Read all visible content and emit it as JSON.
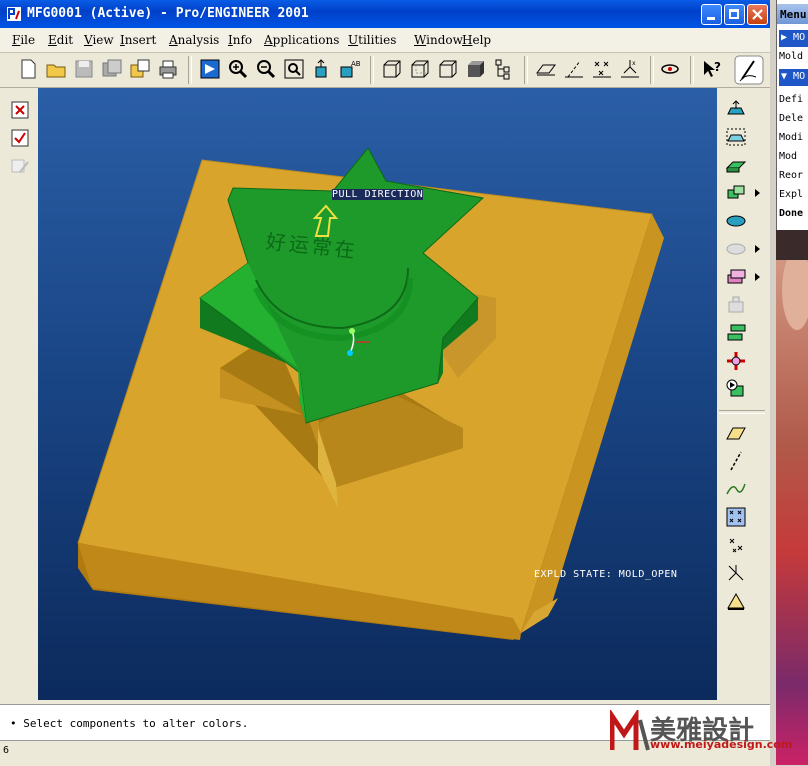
{
  "window": {
    "title": "MFG0001 (Active) - Pro/ENGINEER 2001"
  },
  "menu": {
    "items": [
      {
        "pre": "",
        "ul": "F",
        "rest": "ile"
      },
      {
        "pre": "",
        "ul": "E",
        "rest": "dit"
      },
      {
        "pre": "",
        "ul": "V",
        "rest": "iew"
      },
      {
        "pre": "",
        "ul": "I",
        "rest": "nsert"
      },
      {
        "pre": "",
        "ul": "A",
        "rest": "nalysis"
      },
      {
        "pre": "",
        "ul": "I",
        "rest": "nfo"
      },
      {
        "pre": "",
        "ul": "A",
        "rest": "pplications"
      },
      {
        "pre": "",
        "ul": "U",
        "rest": "tilities"
      },
      {
        "pre": "",
        "ul": "W",
        "rest": "indow"
      },
      {
        "pre": "",
        "ul": "H",
        "rest": "elp"
      }
    ]
  },
  "viewport": {
    "pull_direction_label": "PULL DIRECTION",
    "explode_state_label": "EXPLD STATE: MOLD_OPEN",
    "engraved_text": "好运常在",
    "colors": {
      "plate": "#d4a028",
      "part": "#1e9a2a",
      "background_top": "#2a5ea6",
      "background_bottom": "#0c2a5c"
    }
  },
  "status": {
    "message": "• Select components to alter colors.",
    "cmd_prefix": "6"
  },
  "menu_manager": {
    "title": "Menu",
    "rows": [
      "Mold",
      "Defi",
      "Dele",
      "Modi",
      "Mod",
      "Reor",
      "Expl",
      "Done"
    ],
    "header1": "MO",
    "header2": "MO"
  },
  "watermark": {
    "logo_text": "美雅設計",
    "url": "www.meiyadesign.com"
  }
}
